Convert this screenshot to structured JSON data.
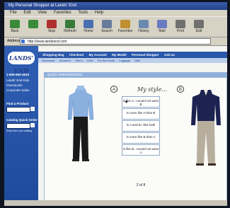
{
  "window": {
    "title": "My Personal Shopper at Lands' End"
  },
  "menu": [
    "File",
    "Edit",
    "View",
    "Favorites",
    "Tools",
    "Help"
  ],
  "toolbar": [
    {
      "label": "Back",
      "icon": "back-arrow-icon",
      "color": "#3a8a3a"
    },
    {
      "label": "",
      "icon": "forward-arrow-icon",
      "color": "#3a8a3a"
    },
    {
      "label": "Stop",
      "icon": "stop-icon",
      "color": "#b03030"
    },
    {
      "label": "Refresh",
      "icon": "refresh-icon",
      "color": "#3a7a3a"
    },
    {
      "label": "Home",
      "icon": "home-icon",
      "color": "#4a6fb0"
    },
    {
      "label": "Search",
      "icon": "search-icon",
      "color": "#6a7a9a"
    },
    {
      "label": "Favorites",
      "icon": "favorites-icon",
      "color": "#c09030"
    },
    {
      "label": "History",
      "icon": "history-icon",
      "color": "#6a8ab0"
    },
    {
      "label": "Mail",
      "icon": "mail-icon",
      "color": "#6a7ac0"
    },
    {
      "label": "Print",
      "icon": "print-icon",
      "color": "#707070"
    },
    {
      "label": "Edit",
      "icon": "edit-icon",
      "color": "#707070"
    }
  ],
  "address": {
    "label": "Address",
    "url": "http://www.landsend.com"
  },
  "brand": {
    "logo_text": "LANDS' END",
    "phone": "1-800-963-4816"
  },
  "sidebar": {
    "links": [
      "Lands' End Kids",
      "Overstocks",
      "Corporate Sales"
    ],
    "find_label": "Find a Product",
    "catalog_label": "Catalog Quick Order",
    "catalog_sub": "Shop from your catalog"
  },
  "topnav": [
    "Shopping Bag",
    "Checkout",
    "My Account",
    "My Model",
    "Personal Shopper",
    "Ask Us"
  ],
  "subnav": [
    "Outerwear",
    "Women's",
    "Men's",
    "Kid's",
    "For the Home",
    "Luggage",
    "Gifts"
  ],
  "quick_prefs": {
    "title": "QUICK PREFERENCES"
  },
  "style": {
    "left_marker": "A",
    "right_marker": "B",
    "heading": "My style...",
    "choices": [
      "is like A, I would not wear B",
      "is more like A than B",
      "is A and B I like both",
      "is more like B than A",
      "is like B, I would not wear A"
    ],
    "pager": "2 of 8"
  },
  "colors": {
    "accent": "#2a57a8",
    "sidebar": "#2f5fb4",
    "prefs_bar": "#8fb0db",
    "outfit_a_top": "#8ab0e0",
    "outfit_a_bottom": "#1a1a1a",
    "outfit_b_top": "#1c2350",
    "outfit_b_bottom": "#b8ae9e"
  }
}
